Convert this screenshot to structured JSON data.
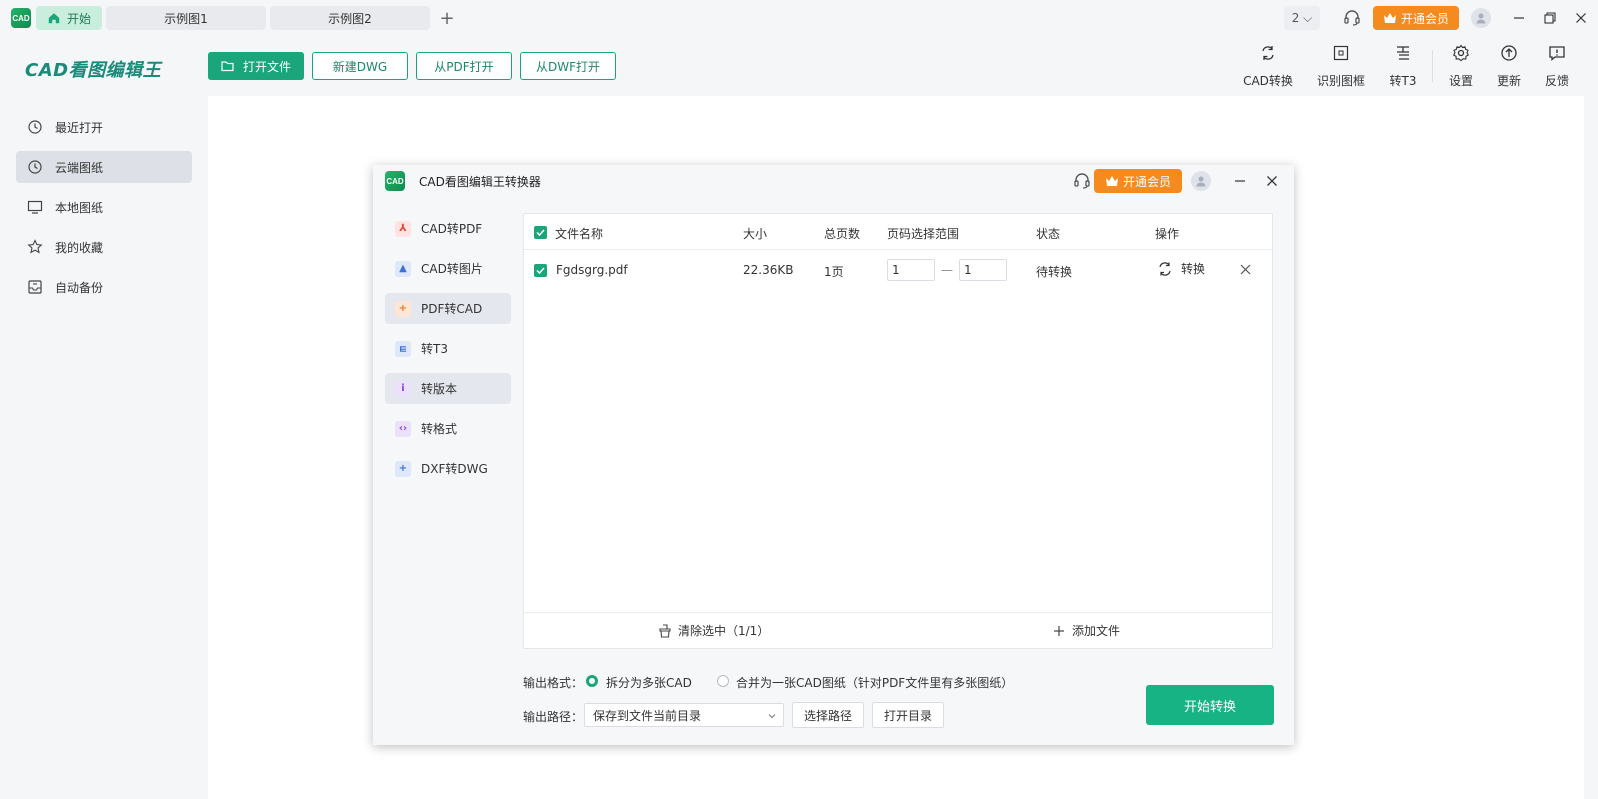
{
  "titlebar": {
    "logo_text": "CAD",
    "tabs": [
      {
        "label": "开始"
      },
      {
        "label": "示例图1"
      },
      {
        "label": "示例图2"
      }
    ],
    "add_tab": "+",
    "num_label": "2 ⌵",
    "vip_label": "开通会员"
  },
  "brand": "CAD看图编辑王",
  "toolbar": {
    "open_file": "打开文件",
    "new_dwg": "新建DWG",
    "open_pdf": "从PDF打开",
    "open_dwf": "从DWF打开",
    "tools": [
      {
        "label": "CAD转换"
      },
      {
        "label": "识别图框"
      },
      {
        "label": "转T3"
      },
      {
        "label": "设置"
      },
      {
        "label": "更新"
      },
      {
        "label": "反馈"
      }
    ]
  },
  "sidebar": {
    "items": [
      {
        "label": "最近打开"
      },
      {
        "label": "云端图纸"
      },
      {
        "label": "本地图纸"
      },
      {
        "label": "我的收藏"
      },
      {
        "label": "自动备份"
      }
    ]
  },
  "dialog": {
    "logo_text": "CAD",
    "title": "CAD看图编辑王转换器",
    "vip_label": "开通会员",
    "nav": [
      {
        "label": "CAD转PDF"
      },
      {
        "label": "CAD转图片"
      },
      {
        "label": "PDF转CAD"
      },
      {
        "label": "转T3"
      },
      {
        "label": "转版本"
      },
      {
        "label": "转格式"
      },
      {
        "label": "DXF转DWG"
      }
    ],
    "table": {
      "headers": [
        "文件名称",
        "大小",
        "总页数",
        "页码选择范围",
        "状态",
        "操作"
      ],
      "rows": [
        {
          "name": "Fgdsgrg.pdf",
          "size": "22.36KB",
          "pages": "1页",
          "from": "1",
          "dash": "—",
          "to": "1",
          "status": "待转换",
          "action": "转换"
        }
      ]
    },
    "clear_label": "清除选中（1/1）",
    "add_label": "添加文件",
    "output_format_label": "输出格式：",
    "opt_split": "拆分为多张CAD",
    "opt_merge": "合并为一张CAD图纸（针对PDF文件里有多张图纸）",
    "output_path_label": "输出路径：",
    "path_value": "保存到文件当前目录",
    "choose_path": "选择路径",
    "open_dir": "打开目录",
    "start": "开始转换"
  },
  "colors": {
    "accent": "#1aa57b",
    "vip": "#f58a1f",
    "brand": "#1a8a7a"
  }
}
